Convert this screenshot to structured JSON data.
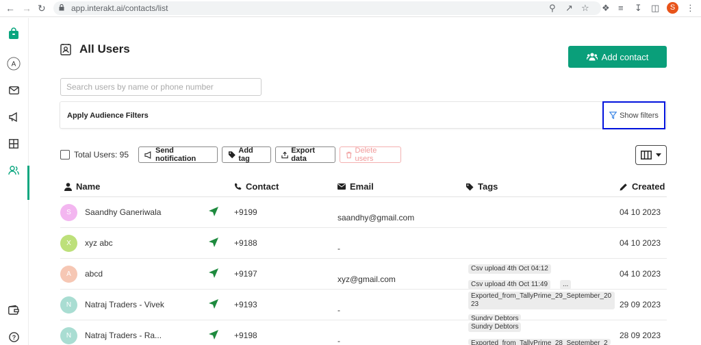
{
  "browser": {
    "url": "app.interakt.ai/contacts/list",
    "profile_initial": "S"
  },
  "sidebar": {
    "items": [
      {
        "icon": "bag-icon"
      },
      {
        "icon": "avatar-a-icon",
        "label": "A"
      },
      {
        "icon": "mail-icon"
      },
      {
        "icon": "megaphone-icon"
      },
      {
        "icon": "grid-icon"
      },
      {
        "icon": "users-icon",
        "active": true
      },
      {
        "icon": "wallet-icon"
      },
      {
        "icon": "help-icon"
      }
    ],
    "accent": "#0aa67f"
  },
  "page": {
    "title": "All Users",
    "add_contact_label": "Add contact",
    "search_placeholder": "Search users by name or phone number",
    "filter_label": "Apply Audience Filters",
    "show_filters_label": "Show filters"
  },
  "actions": {
    "total_label": "Total Users: 95",
    "send_notification": "Send notification",
    "add_tag": "Add tag",
    "export_data": "Export data",
    "delete_users": "Delete users"
  },
  "table": {
    "columns": [
      "Name",
      "Contact",
      "Email",
      "Tags",
      "Created"
    ],
    "rows": [
      {
        "initial": "S",
        "avatar_color": "#f3b6f0",
        "name": "Saandhy Ganeriwala",
        "phone": "+9199",
        "email": "saandhy@gmail.com",
        "tags": [],
        "created": "04 10 2023"
      },
      {
        "initial": "X",
        "avatar_color": "#bde07a",
        "name": "xyz abc",
        "phone": "+9188",
        "email": "-",
        "tags": [],
        "created": "04 10 2023"
      },
      {
        "initial": "A",
        "avatar_color": "#f6c7b4",
        "name": "abcd",
        "phone": "+9197",
        "email": "xyz@gmail.com",
        "tags": [
          "Csv upload 4th Oct 04:12",
          "Csv upload 4th Oct 11:49",
          "..."
        ],
        "created": "04 10 2023"
      },
      {
        "initial": "N",
        "avatar_color": "#a9ddd2",
        "name": "Natraj Traders - Vivek",
        "phone": "+9193",
        "email": "-",
        "tags": [
          "Exported_from_TallyPrime_29_September_2023",
          "Sundry Debtors"
        ],
        "created": "29 09 2023"
      },
      {
        "initial": "N",
        "avatar_color": "#a9ddd2",
        "name": "Natraj Traders - Ra...",
        "phone": "+9198",
        "email": "-",
        "tags": [
          "Sundry Debtors",
          "Exported_from_TallyPrime_28_September_2"
        ],
        "created": "28 09 2023"
      }
    ]
  },
  "colors": {
    "primary": "#0a9f7a",
    "highlight_border": "#0011dd",
    "delete_disabled": "#f19999"
  }
}
